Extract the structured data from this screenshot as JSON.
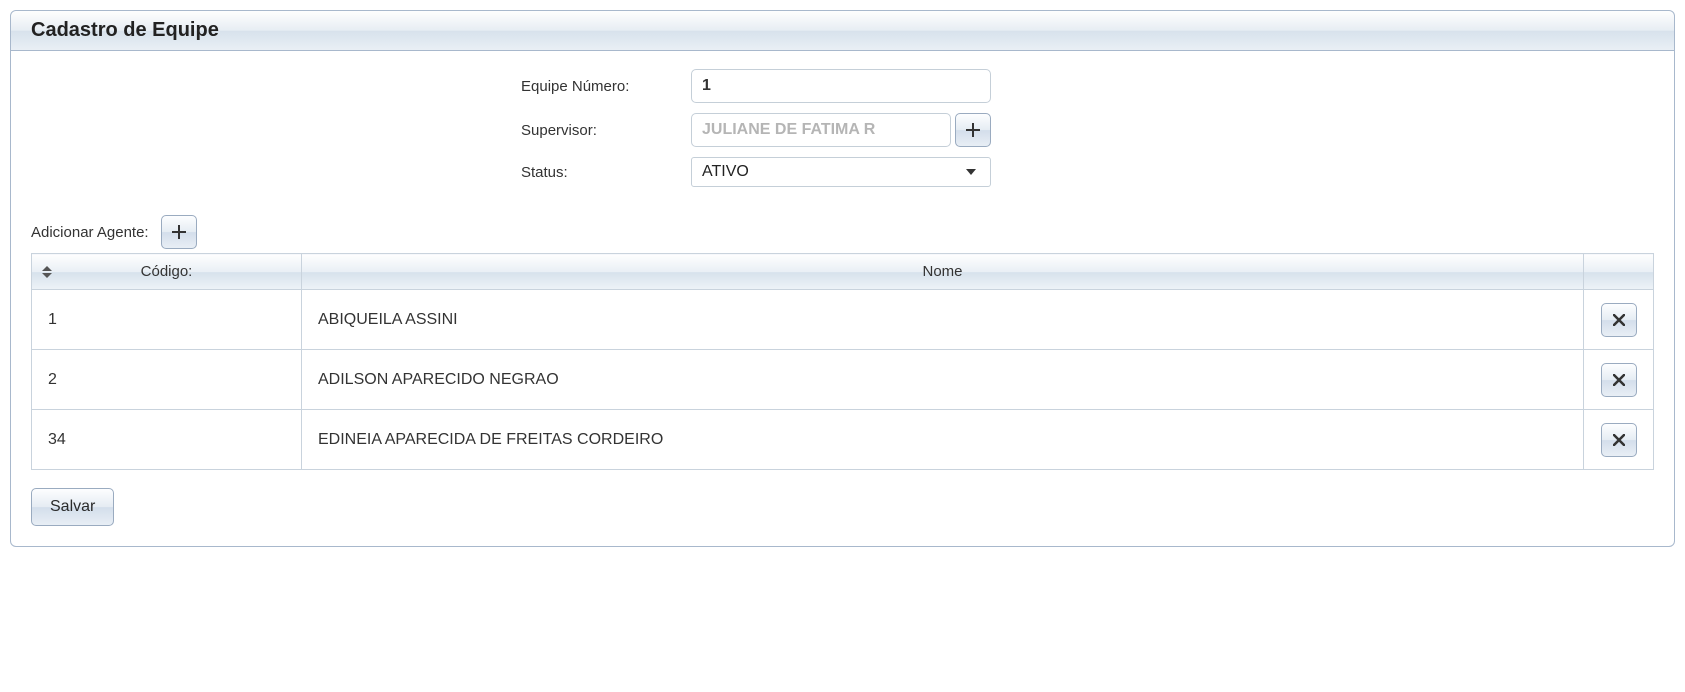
{
  "panel": {
    "title": "Cadastro de Equipe"
  },
  "form": {
    "equipe_numero_label": "Equipe Número:",
    "equipe_numero_value": "1",
    "supervisor_label": "Supervisor:",
    "supervisor_value": "JULIANE DE FATIMA R",
    "status_label": "Status:",
    "status_value": "ATIVO"
  },
  "add_agent": {
    "label": "Adicionar Agente:"
  },
  "table": {
    "headers": {
      "codigo": "Código:",
      "nome": "Nome"
    },
    "rows": [
      {
        "codigo": "1",
        "nome": "ABIQUEILA ASSINI"
      },
      {
        "codigo": "2",
        "nome": "ADILSON APARECIDO NEGRAO"
      },
      {
        "codigo": "34",
        "nome": "EDINEIA APARECIDA DE FREITAS CORDEIRO"
      }
    ]
  },
  "actions": {
    "save": "Salvar"
  }
}
